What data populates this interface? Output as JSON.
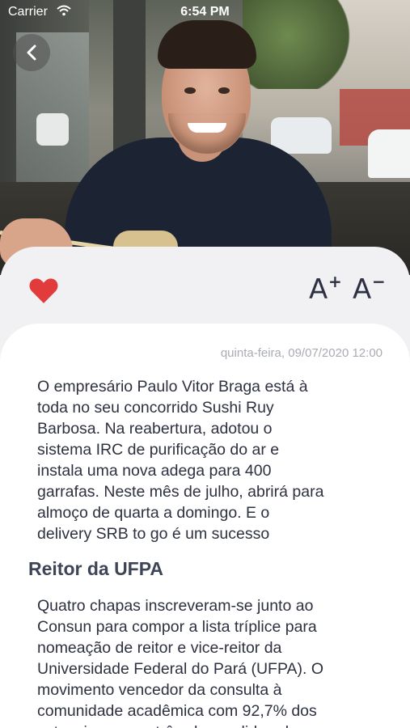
{
  "status_bar": {
    "carrier": "Carrier",
    "time": "6:54 PM"
  },
  "toolbar": {
    "font_increase": "A",
    "font_decrease": "A",
    "font_increase_symbol": "+",
    "font_decrease_symbol": "−"
  },
  "article": {
    "date": "quinta-feira, 09/07/2020 12:00",
    "paragraph1": "O empresário Paulo Vitor Braga está à\ntoda no seu concorrido Sushi Ruy\nBarbosa. Na reabertura, adotou o\nsistema IRC de purificação do ar e\ninstala uma nova adega para 400\ngarrafas. Neste mês de julho, abrirá para\nalmoço de quarta a domingo. E o\ndelivery SRB to go é um sucesso",
    "subheading": "Reitor da UFPA",
    "paragraph2": "Quatro chapas inscreveram-se junto ao\nConsun para compor a lista tríplice para\nnomeação de reitor e vice-reitor da\nUniversidade Federal do Pará (UFPA). O\nmovimento vencedor da consulta à\ncomunidade acadêmica com 92,7% dos\nvotos, inscreveu três chapas lideradas"
  },
  "colors": {
    "heart": "#e23b3b",
    "text": "#2e3140",
    "muted": "#a9acb2"
  }
}
